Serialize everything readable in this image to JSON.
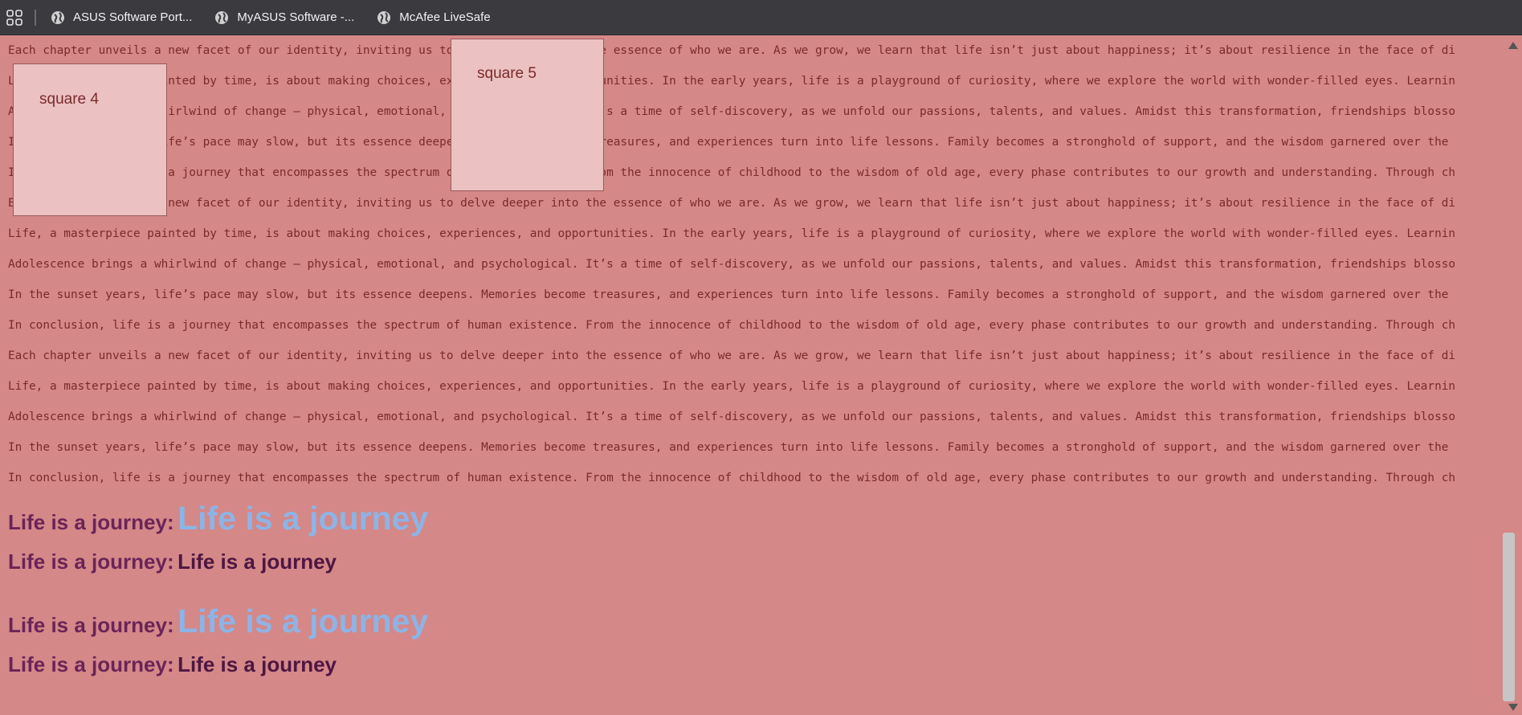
{
  "bookmarks": [
    {
      "label": "ASUS Software Port...",
      "icon": "globe-icon"
    },
    {
      "label": "MyASUS Software -...",
      "icon": "globe-icon"
    },
    {
      "label": "McAfee LiveSafe",
      "icon": "globe-icon"
    }
  ],
  "lines": [
    "Each chapter unveils a new facet of our identity, inviting us to delve deeper into the essence of who we are. As we grow, we learn that life isn’t just about happiness; it’s about resilience in the face of di",
    "Life, a masterpiece painted by time, is about making choices, experiences, and opportunities. In the early years, life is a playground of curiosity, where we explore the world with wonder-filled eyes. Learnin",
    "Adolescence brings a whirlwind of change – physical, emotional, and psychological. It’s a time of self-discovery, as we unfold our passions, talents, and values. Amidst this transformation, friendships blosso",
    "In the sunset years, life’s pace may slow, but its essence deepens. Memories become treasures, and experiences turn into life lessons. Family becomes a stronghold of support, and the wisdom garnered over the",
    "In conclusion, life is a journey that encompasses the spectrum of human existence. From the innocence of childhood to the wisdom of old age, every phase contributes to our growth and understanding. Through ch",
    "Each chapter unveils a new facet of our identity, inviting us to delve deeper into the essence of who we are. As we grow, we learn that life isn’t just about happiness; it’s about resilience in the face of di",
    "Life, a masterpiece painted by time, is about making choices, experiences, and opportunities. In the early years, life is a playground of curiosity, where we explore the world with wonder-filled eyes. Learnin",
    "Adolescence brings a whirlwind of change – physical, emotional, and psychological. It’s a time of self-discovery, as we unfold our passions, talents, and values. Amidst this transformation, friendships blosso",
    "In the sunset years, life’s pace may slow, but its essence deepens. Memories become treasures, and experiences turn into life lessons. Family becomes a stronghold of support, and the wisdom garnered over the",
    "In conclusion, life is a journey that encompasses the spectrum of human existence. From the innocence of childhood to the wisdom of old age, every phase contributes to our growth and understanding. Through ch",
    "Each chapter unveils a new facet of our identity, inviting us to delve deeper into the essence of who we are. As we grow, we learn that life isn’t just about happiness; it’s about resilience in the face of di",
    "Life, a masterpiece painted by time, is about making choices, experiences, and opportunities. In the early years, life is a playground of curiosity, where we explore the world with wonder-filled eyes. Learnin",
    "Adolescence brings a whirlwind of change – physical, emotional, and psychological. It’s a time of self-discovery, as we unfold our passions, talents, and values. Amidst this transformation, friendships blosso",
    "In the sunset years, life’s pace may slow, but its essence deepens. Memories become treasures, and experiences turn into life lessons. Family becomes a stronghold of support, and the wisdom garnered over the",
    "In conclusion, life is a journey that encompasses the spectrum of human existence. From the innocence of childhood to the wisdom of old age, every phase contributes to our growth and understanding. Through ch"
  ],
  "squares": {
    "square4": "square 4",
    "square5": "square 5"
  },
  "headings": [
    {
      "prefix": "Life is a journey:",
      "text": "Life is a journey"
    },
    {
      "prefix": "Life is a journey:",
      "text": "Life is a journey"
    },
    {
      "prefix": "Life is a journey:",
      "text": "Life is a journey"
    },
    {
      "prefix": "Life is a journey:",
      "text": "Life is a journey"
    }
  ],
  "colors": {
    "page_background": "#d48888",
    "bookmarks_bar": "#3b3b3f",
    "body_text": "#7c2a2a",
    "heading_prefix": "#6b2458",
    "heading_big": "#8db4e6",
    "heading_dark": "#4e1642",
    "square_fill": "#ebc1c1"
  }
}
